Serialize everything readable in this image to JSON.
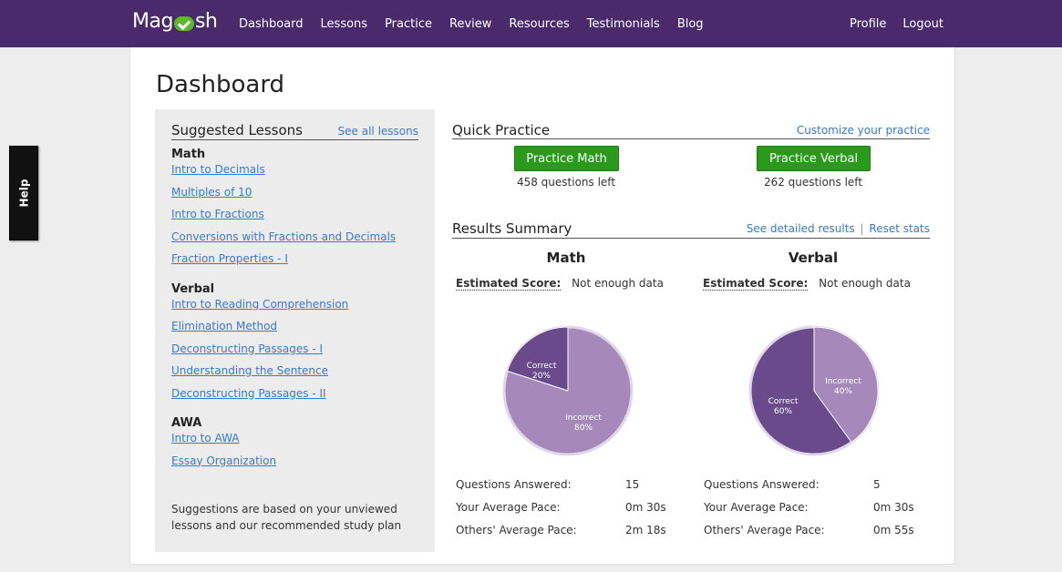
{
  "brand": {
    "name_left": "Mag",
    "name_right": "sh",
    "badge_color": "#5bb827"
  },
  "nav": {
    "left": [
      "Dashboard",
      "Lessons",
      "Practice",
      "Review",
      "Resources",
      "Testimonials",
      "Blog"
    ],
    "right": [
      "Profile",
      "Logout"
    ]
  },
  "help_tab": "Help",
  "page_title": "Dashboard",
  "sidebar": {
    "title": "Suggested Lessons",
    "see_all": "See all lessons",
    "sections": [
      {
        "title": "Math",
        "lessons": [
          "Intro to Decimals",
          "Multiples of 10",
          "Intro to Fractions",
          "Conversions with Fractions and Decimals",
          "Fraction Properties - I"
        ]
      },
      {
        "title": "Verbal",
        "lessons": [
          "Intro to Reading Comprehension",
          "Elimination Method",
          "Deconstructing Passages - I",
          "Understanding the Sentence",
          "Deconstructing Passages - II"
        ]
      },
      {
        "title": "AWA",
        "lessons": [
          "Intro to AWA",
          "Essay Organization"
        ]
      }
    ],
    "note": "Suggestions are based on your unviewed lessons and our recommended study plan"
  },
  "quick_practice": {
    "title": "Quick Practice",
    "customize": "Customize your practice",
    "math_button": "Practice Math",
    "math_left": "458 questions left",
    "verbal_button": "Practice Verbal",
    "verbal_left": "262 questions left"
  },
  "results": {
    "title": "Results Summary",
    "detailed_link": "See detailed results",
    "separator": "|",
    "reset_link": "Reset stats",
    "estimated_label": "Estimated Score:",
    "math": {
      "title": "Math",
      "estimated_value": "Not enough data",
      "pie": {
        "correct_label": "Correct",
        "correct_pct": "20%",
        "incorrect_label": "Incorrect",
        "incorrect_pct": "80%"
      },
      "stats": [
        {
          "k": "Questions Answered:",
          "v": "15"
        },
        {
          "k": "Your Average Pace:",
          "v": "0m 30s"
        },
        {
          "k": "Others' Average Pace:",
          "v": "2m 18s"
        }
      ]
    },
    "verbal": {
      "title": "Verbal",
      "estimated_value": "Not enough data",
      "pie": {
        "correct_label": "Correct",
        "correct_pct": "60%",
        "incorrect_label": "Incorrect",
        "incorrect_pct": "40%"
      },
      "stats": [
        {
          "k": "Questions Answered:",
          "v": "5"
        },
        {
          "k": "Your Average Pace:",
          "v": "0m 30s"
        },
        {
          "k": "Others' Average Pace:",
          "v": "0m 55s"
        }
      ]
    }
  },
  "colors": {
    "nav_bg": "#4a2a6b",
    "correct": "#6a4a8a",
    "incorrect": "#a688bb",
    "button": "#2a9a1c",
    "link": "#3a78c9"
  }
}
